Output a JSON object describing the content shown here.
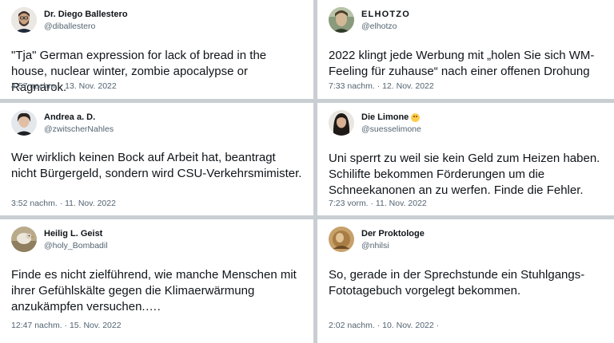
{
  "tweets": [
    {
      "display_name": "Dr. Diego Ballestero",
      "handle": "@diballestero",
      "text": "\"Tja\" German expression for lack of bread in the house, nuclear winter, zombie apocalypse or Ragnarok.",
      "timestamp": "4:57 nachm. · 13. Nov. 2022",
      "avatar": "man-with-beard-avatar"
    },
    {
      "display_name": "ELHOTZO",
      "handle": "@elhotzo",
      "text": "2022 klingt jede Werbung mit „holen Sie sich WM-Feeling für zuhause“ nach einer offenen Drohung",
      "timestamp": "7:33 nachm. · 12. Nov. 2022",
      "avatar": "painted-portrait-avatar"
    },
    {
      "display_name": "Andrea a. D.",
      "handle": "@zwitscherNahles",
      "text": "Wer wirklich keinen Bock auf Arbeit hat, beantragt nicht Bürgergeld, sondern wird CSU-Verkehrsmimister.",
      "timestamp": "3:52 nachm. · 11. Nov. 2022",
      "avatar": "woman-short-hair-avatar"
    },
    {
      "display_name": "Die Limone",
      "handle": "@suesselimone",
      "text": "Uni sperrt zu weil sie kein Geld zum Heizen haben. Schilifte bekommen Förderungen um die Schneekanonen an zu werfen. Finde die Fehler.",
      "timestamp": "7:23 vorm. · 11. Nov. 2022",
      "avatar": "woman-long-hair-avatar",
      "emoji": "smiling-emoji"
    },
    {
      "display_name": "Heilig L. Geist",
      "handle": "@holy_Bombadil",
      "text": "Finde es nicht zielführend, wie manche Menschen mit ihrer Gefühlskälte gegen die Klimaerwärmung anzukämpfen versuchen.….",
      "timestamp": "12:47 nachm. · 15. Nov. 2022",
      "avatar": "bird-photo-avatar"
    },
    {
      "display_name": "Der Proktologe",
      "handle": "@nhilsi",
      "text": "So, gerade in der Sprechstunde ein Stuhlgangs-Fototagebuch vorgelegt bekommen.",
      "timestamp": "2:02 nachm. · 10. Nov. 2022 ·",
      "avatar": "sepia-photo-avatar"
    }
  ]
}
